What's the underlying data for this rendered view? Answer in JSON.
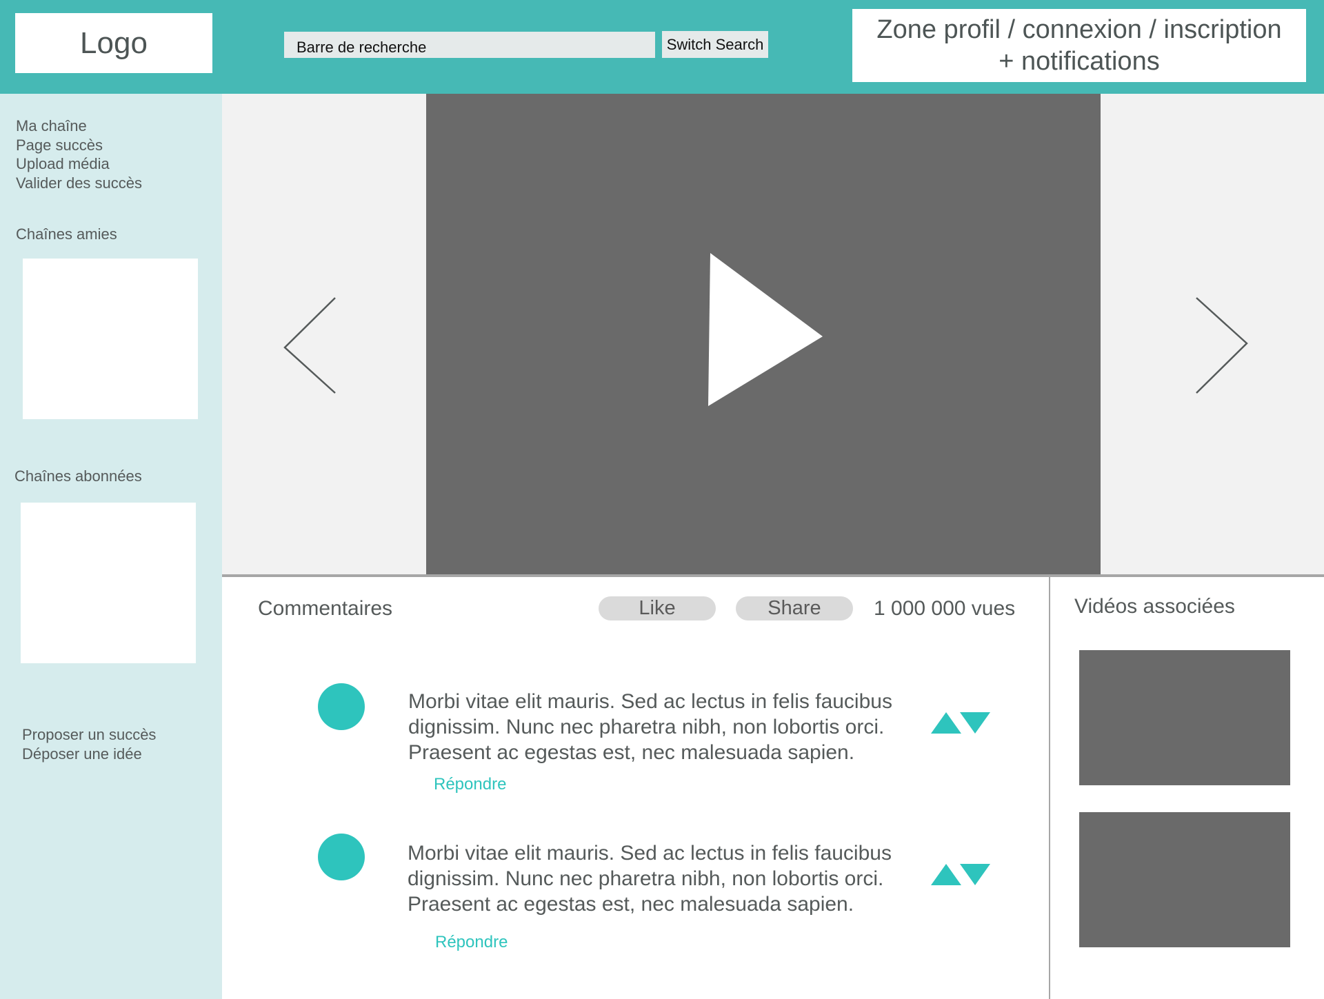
{
  "header": {
    "logo": "Logo",
    "search_placeholder": "Barre de recherche",
    "switch_label": "Switch Search",
    "profile_line1": "Zone profil / connexion / inscription",
    "profile_line2": "+ notifications"
  },
  "sidebar": {
    "links": [
      "Ma chaîne",
      "Page succès",
      "Upload média",
      "Valider des succès"
    ],
    "friends_heading": "Chaînes amies",
    "subscriptions_heading": "Chaînes abonnées",
    "bottom_links": [
      "Proposer un succès",
      "Déposer une idée"
    ]
  },
  "player": {
    "play_icon": "play-icon",
    "prev_icon": "chevron-left-icon",
    "next_icon": "chevron-right-icon"
  },
  "comments": {
    "title": "Commentaires",
    "like_label": "Like",
    "share_label": "Share",
    "views": "1 000 000 vues",
    "items": [
      {
        "lines": [
          "Morbi vitae elit mauris. Sed ac lectus in felis faucibus",
          "dignissim. Nunc nec pharetra nibh, non lobortis orci.",
          "Praesent ac egestas est, nec malesuada sapien."
        ],
        "reply": "Répondre"
      },
      {
        "lines": [
          "Morbi vitae elit mauris. Sed ac lectus in felis faucibus",
          "dignissim. Nunc nec pharetra nibh, non lobortis orci.",
          "Praesent ac egestas est, nec malesuada sapien."
        ],
        "reply": "Répondre"
      }
    ]
  },
  "related": {
    "title": "Vidéos associées"
  },
  "colors": {
    "header_bg": "#46b9b5",
    "sidebar_bg": "#d6eced",
    "accent": "#2ec4bd",
    "player_bg": "#6a6a6a",
    "stage_bg": "#f2f2f2"
  }
}
